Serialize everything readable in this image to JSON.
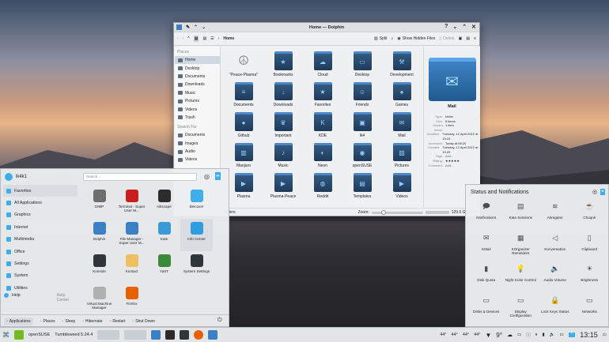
{
  "dolphin": {
    "title": "Home — Dolphin",
    "breadcrumb": "Home",
    "split": "Split",
    "hidden": "Show Hidden Files",
    "delete": "Delete",
    "places_header": "Places",
    "search_header": "Search For",
    "places": [
      "Home",
      "Desktop",
      "Documents",
      "Downloads",
      "Music",
      "Pictures",
      "Videos",
      "Trash"
    ],
    "search": [
      "Documents",
      "Images",
      "Audio",
      "Videos"
    ],
    "items": [
      {
        "name": "\"Peace-Plasma\"",
        "icon": "☮"
      },
      {
        "name": "Bookmarks",
        "icon": "★"
      },
      {
        "name": "Cloud",
        "icon": "☁"
      },
      {
        "name": "Desktop",
        "icon": "▭"
      },
      {
        "name": "Development",
        "icon": "⚒"
      },
      {
        "name": "Documents",
        "icon": "≡"
      },
      {
        "name": "Downloads",
        "icon": "↓"
      },
      {
        "name": "Favorites",
        "icon": "★"
      },
      {
        "name": "Friends",
        "icon": "☺"
      },
      {
        "name": "Games",
        "icon": "♠"
      },
      {
        "name": "Github",
        "icon": "●"
      },
      {
        "name": "Important",
        "icon": "♛"
      },
      {
        "name": "KDE",
        "icon": "K"
      },
      {
        "name": "lk4",
        "icon": "▣"
      },
      {
        "name": "Mail",
        "icon": "✉"
      },
      {
        "name": "Manjaro",
        "icon": "▥"
      },
      {
        "name": "Music",
        "icon": "♪"
      },
      {
        "name": "Neon",
        "icon": "◐"
      },
      {
        "name": "openSUSE",
        "icon": "◉"
      },
      {
        "name": "Pictures",
        "icon": "▨"
      },
      {
        "name": "Plasma",
        "icon": "▶"
      },
      {
        "name": "Plasma-Peace",
        "icon": "▶"
      },
      {
        "name": "Reddit",
        "icon": "◍"
      },
      {
        "name": "Templates",
        "icon": "▤"
      },
      {
        "name": "Videos",
        "icon": "▶"
      }
    ],
    "info": {
      "name": "Mail",
      "meta": [
        [
          "Type:",
          "folder"
        ],
        [
          "Size:",
          "8 items"
        ],
        [
          "Hidden items:",
          "1 item"
        ],
        [
          "Modified:",
          "Tuesday, 12 April 2022 at 10:24"
        ],
        [
          "Accessed:",
          "Today at 08:20"
        ],
        [
          "Created:",
          "Tuesday, 12 April 2022 at 10:29"
        ],
        [
          "Tags:",
          "Add..."
        ],
        [
          "Rating:",
          "★★★★★"
        ],
        [
          "Comment:",
          "Add..."
        ]
      ]
    },
    "status_left": "olders",
    "zoom_label": "Zoom:",
    "free": "129.5 GiB free"
  },
  "launcher": {
    "user": "lk4k1",
    "search_placeholder": "Search...",
    "cats": [
      "Favorites",
      "All Applications",
      "Graphics",
      "Internet",
      "Multimedia",
      "Office",
      "Settings",
      "System",
      "Utilities"
    ],
    "help": "Help",
    "help_center": "Help Center",
    "apps": [
      {
        "name": "GIMP",
        "color": "#6e6e6e"
      },
      {
        "name": "Terminal - Super User M...",
        "color": "#c81e1e"
      },
      {
        "name": "Inkscape",
        "color": "#2b2b2b"
      },
      {
        "name": "Discover",
        "color": "#3daee9"
      },
      {
        "name": "Dolphin",
        "color": "#3b7fc4"
      },
      {
        "name": "File Manager - Super User M...",
        "color": "#3b7fc4"
      },
      {
        "name": "Kate",
        "color": "#3c9ad6"
      },
      {
        "name": "Info Center",
        "color": "#2f9ee0"
      },
      {
        "name": "Konsole",
        "color": "#31363b"
      },
      {
        "name": "Kontact",
        "color": "#f0c060"
      },
      {
        "name": "YaST",
        "color": "#3b8a3b"
      },
      {
        "name": "System Settings",
        "color": "#31363b"
      },
      {
        "name": "Virtual Machine Manager",
        "color": "#b0b0b0"
      },
      {
        "name": "Firefox",
        "color": "#e66000"
      }
    ],
    "footer": [
      "Applications",
      "Places",
      "Sleep",
      "Hibernate",
      "Restart",
      "Shut Down"
    ]
  },
  "tray": {
    "title": "Status and Notifications",
    "items": [
      {
        "name": "Notifications",
        "icon": "🗩"
      },
      {
        "name": "Kate Sessions",
        "icon": "▤"
      },
      {
        "name": "Akregator",
        "icon": "≋"
      },
      {
        "name": "Choqok",
        "icon": "☕"
      },
      {
        "name": "KMail",
        "icon": "✉"
      },
      {
        "name": "KOrganizer Reminders",
        "icon": "▦"
      },
      {
        "name": "Konversation",
        "icon": "◁"
      },
      {
        "name": "Clipboard",
        "icon": "▯"
      },
      {
        "name": "Disk Quota",
        "icon": "▮"
      },
      {
        "name": "Night Color Control",
        "icon": "💡"
      },
      {
        "name": "Audio Volume",
        "icon": "🔈"
      },
      {
        "name": "Brightness",
        "icon": "☀"
      },
      {
        "name": "Disks & Devices",
        "icon": "▭"
      },
      {
        "name": "Display Configuration",
        "icon": "▭"
      },
      {
        "name": "Lock Keys Status",
        "icon": "🔒"
      },
      {
        "name": "Networks",
        "icon": "▭"
      }
    ]
  },
  "panel": {
    "distro": "openSUSE",
    "version": "Tumbleweed 5.24.4",
    "temps": [
      "44°",
      "44°",
      "44°",
      "44°"
    ],
    "weather": "9°",
    "time": "13:15"
  }
}
